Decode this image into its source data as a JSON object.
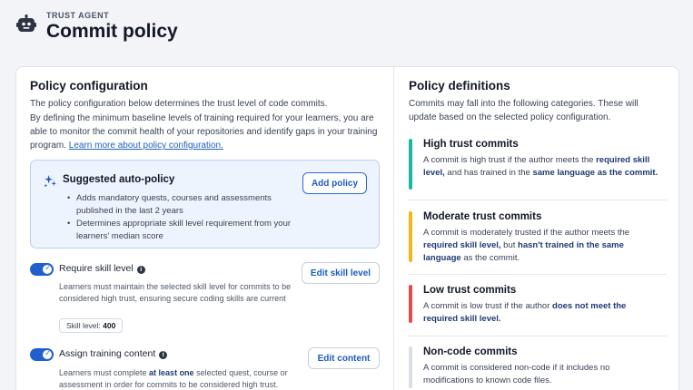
{
  "header": {
    "eyebrow": "TRUST AGENT",
    "title": "Commit policy"
  },
  "config": {
    "title": "Policy configuration",
    "intro": "The policy configuration below determines the trust level of code commits.",
    "body": "By defining the minimum baseline levels of training required for your learners, you are able to monitor the commit health of your repositories and identify gaps in your training program.",
    "link": "Learn more about policy configuration.",
    "suggested": {
      "title": "Suggested auto-policy",
      "bullets": [
        "Adds mandatory quests, courses and assessments published in the last 2 years",
        "Determines appropriate skill level requirement from your learners' median score"
      ],
      "button": "Add policy"
    },
    "skill": {
      "label": "Require skill level",
      "button": "Edit skill level",
      "desc": "Learners must maintain the selected skill level for commits to be considered high trust, ensuring secure coding skills are current",
      "chip_label": "Skill level:",
      "chip_value": "400"
    },
    "training": {
      "label": "Assign training content",
      "button": "Edit content",
      "desc_pre": "Learners must complete ",
      "desc_bold": "at least one",
      "desc_post": " selected quest, course or assessment in order for commits to be considered high trust."
    }
  },
  "definitions": {
    "title": "Policy definitions",
    "intro": "Commits may fall into the following categories. These will update based on the selected policy configuration.",
    "items": [
      {
        "title": "High trust commits",
        "color": "#1bb7a6",
        "t1": "A commit is high trust if the author meets the ",
        "b1": "required skill level,",
        "t2": " and has trained in the ",
        "b2": "same language as the commit.",
        "t3": ""
      },
      {
        "title": "Moderate trust commits",
        "color": "#f3b71b",
        "t1": "A commit is moderately trusted if the author meets the ",
        "b1": "required skill level,",
        "t2": " but ",
        "b2": "hasn't trained in the same language",
        "t3": " as the commit."
      },
      {
        "title": "Low trust commits",
        "color": "#e8474c",
        "t1": "A commit is low trust if the author ",
        "b1": "does not meet the required skill level.",
        "t2": "",
        "b2": "",
        "t3": ""
      },
      {
        "title": "Non-code commits",
        "color": "#d9dde6",
        "t1": "A commit is considered non-code if it includes no modifications to known code files.",
        "b1": "",
        "t2": "",
        "b2": "",
        "t3": ""
      }
    ]
  }
}
